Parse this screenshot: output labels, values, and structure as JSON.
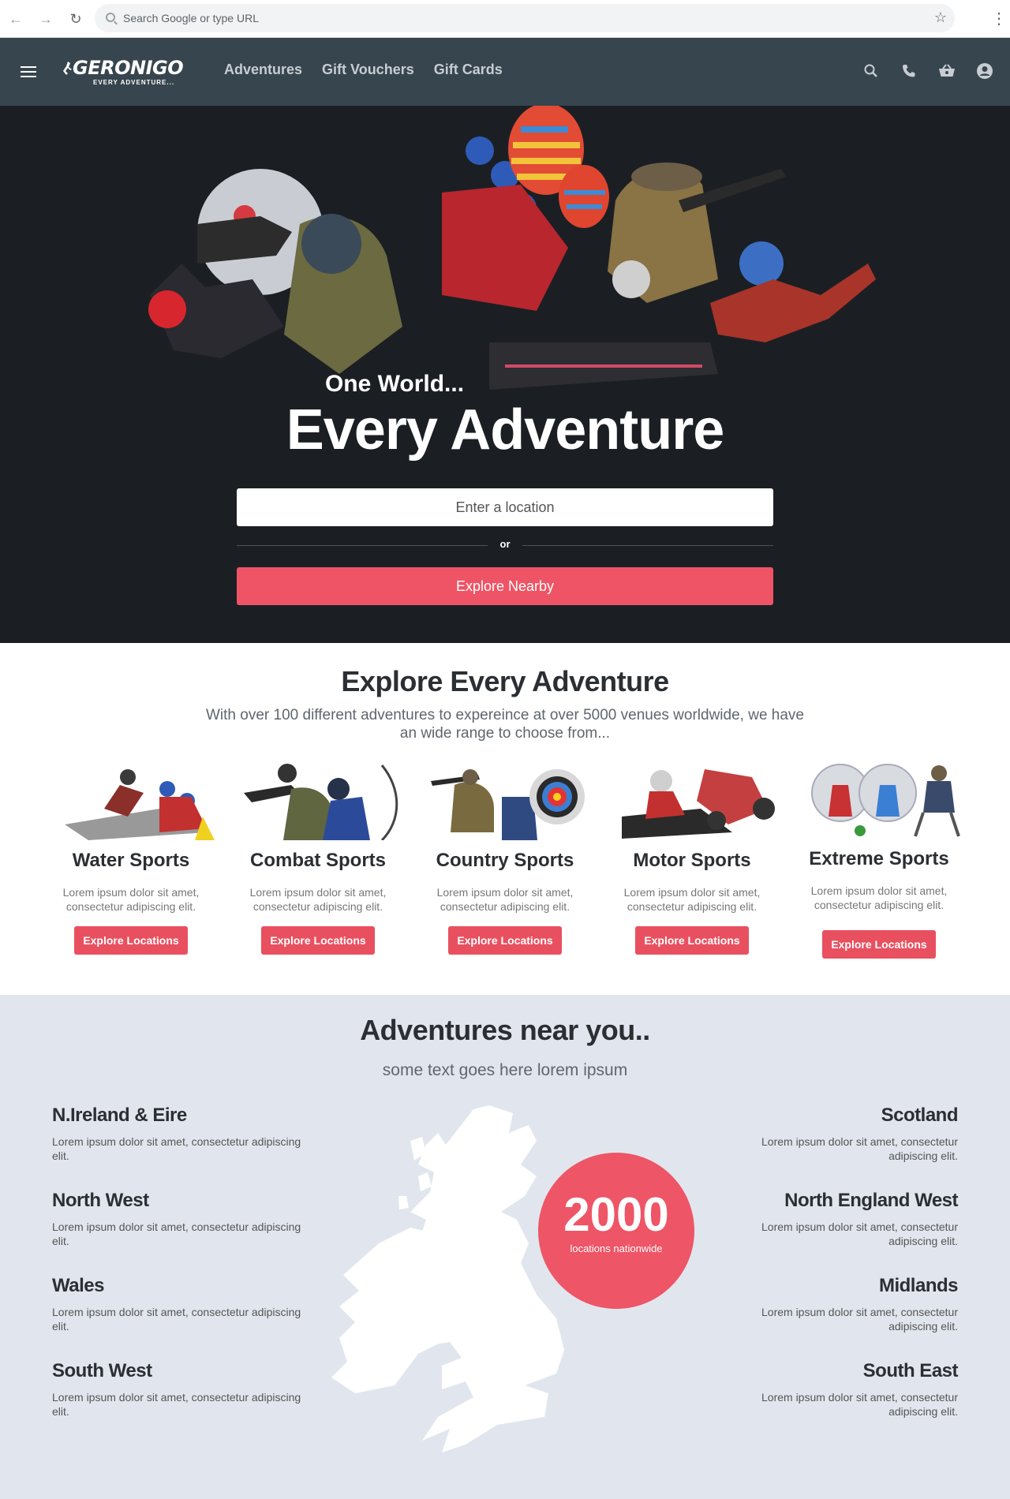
{
  "browser": {
    "omnibox_placeholder": "Search Google or type URL"
  },
  "header": {
    "logo_text": "GERONIGO",
    "logo_tagline": "EVERY ADVENTURE...",
    "nav": [
      "Adventures",
      "Gift Vouchers",
      "Gift Cards"
    ],
    "icons": [
      "search-icon",
      "phone-icon",
      "basket-icon",
      "account-icon"
    ]
  },
  "hero": {
    "subtitle": "One World...",
    "title": "Every Adventure",
    "location_placeholder": "Enter a location",
    "or_label": "or",
    "explore_button": "Explore Nearby"
  },
  "explore": {
    "title": "Explore Every Adventure",
    "description": "With over 100 different adventures to expereince at over 5000 venues worldwide, we have an wide range to choose from...",
    "categories": [
      {
        "name": "Water Sports",
        "desc": "Lorem ipsum dolor sit amet, consectetur adipiscing elit.",
        "button": "Explore Locations"
      },
      {
        "name": "Combat Sports",
        "desc": "Lorem ipsum dolor sit amet, consectetur adipiscing elit.",
        "button": "Explore Locations"
      },
      {
        "name": "Country Sports",
        "desc": "Lorem ipsum dolor sit amet, consectetur adipiscing elit.",
        "button": "Explore Locations"
      },
      {
        "name": "Motor Sports",
        "desc": "Lorem ipsum dolor sit amet, consectetur adipiscing elit.",
        "button": "Explore Locations"
      },
      {
        "name": "Extreme Sports",
        "desc": "Lorem ipsum dolor sit amet, consectetur adipiscing elit.",
        "button": "Explore Locations"
      }
    ]
  },
  "near": {
    "title": "Adventures near you..",
    "subtitle": "some text goes here lorem ipsum",
    "regions_left": [
      {
        "name": "N.Ireland & Eire",
        "desc": "Lorem ipsum dolor sit amet, consectetur adipiscing elit."
      },
      {
        "name": "North West",
        "desc": "Lorem ipsum dolor sit amet, consectetur adipiscing elit."
      },
      {
        "name": "Wales",
        "desc": "Lorem ipsum dolor sit amet, consectetur adipiscing elit."
      },
      {
        "name": "South West",
        "desc": "Lorem ipsum dolor sit amet, consectetur adipiscing elit."
      }
    ],
    "regions_right": [
      {
        "name": "Scotland",
        "desc": "Lorem ipsum dolor sit amet, consectetur adipiscing elit."
      },
      {
        "name": "North England West",
        "desc": "Lorem ipsum dolor sit amet, consectetur adipiscing elit."
      },
      {
        "name": "Midlands",
        "desc": "Lorem ipsum dolor sit amet, consectetur adipiscing elit."
      },
      {
        "name": "South East",
        "desc": "Lorem ipsum dolor sit amet, consectetur adipiscing elit."
      }
    ],
    "stat_number": "2000",
    "stat_caption": "locations nationwide"
  },
  "colors": {
    "accent": "#ee5465",
    "header_bg": "#37454e",
    "hero_bg": "#1b1f24",
    "near_bg": "#e1e6ee"
  }
}
